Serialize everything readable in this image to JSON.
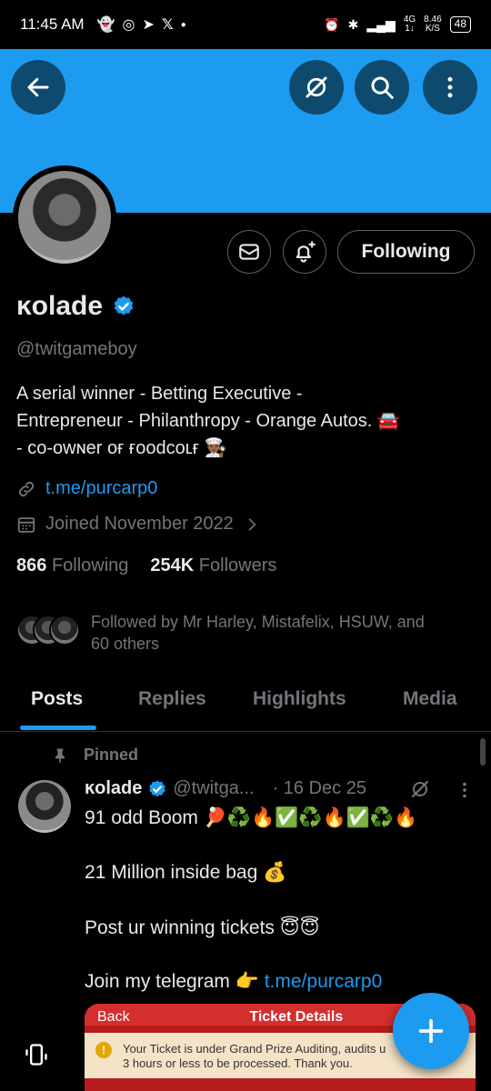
{
  "status_bar": {
    "time": "11:45 AM",
    "network_top": "4G",
    "network_bottom": "1↓",
    "speed_top": "8.46",
    "speed_bottom": "K/S",
    "battery": "48"
  },
  "profile": {
    "name": "ĸolade",
    "handle": "@twitgameboy",
    "bio_line1": "A serial winner  - Betting Executive -",
    "bio_line2": "Entrepreneur - Philanthropy - Orange Autos. 🚘",
    "bio_line3": "- co-owɴer ᴏғ ғoodcoʟғ 👨🏾‍🍳",
    "link": "t.me/purcarp0",
    "joined": "Joined November 2022",
    "following_count": "866",
    "following_label": "Following",
    "followers_count": "254K",
    "followers_label": "Followers",
    "followed_by_line1": "Followed by Mr Harley, Mistafelix, HSUW, and",
    "followed_by_line2": "60 others",
    "follow_button": "Following"
  },
  "tabs": [
    "Posts",
    "Replies",
    "Highlights",
    "Media"
  ],
  "post": {
    "pinned_label": "Pinned",
    "name": "ĸolade",
    "handle": "@twitga...",
    "date": "· 16 Dec 25",
    "line1": "91 odd Boom 🏓♻️🔥✅♻️🔥✅♻️🔥",
    "line2": "21 Million inside bag 💰",
    "line3": "Post ur winning tickets 😇😇",
    "line4_text": "Join my telegram 👉 ",
    "line4_link": "t.me/purcarp0",
    "embed_back": "Back",
    "embed_title": "Ticket Details",
    "embed_notice_line1": "Your Ticket is under Grand Prize Auditing, audits u",
    "embed_notice_line2": "3 hours or less to be processed. Thank you."
  },
  "colors": {
    "accent": "#1d9bf0",
    "background": "#000000",
    "muted": "#71767b"
  }
}
